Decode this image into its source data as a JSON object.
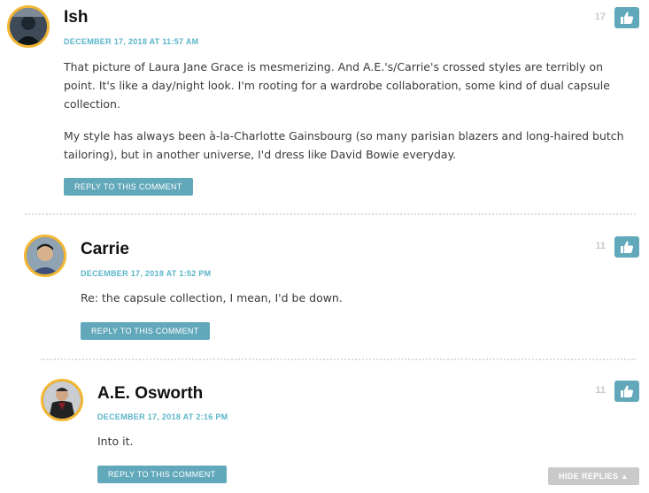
{
  "comments": [
    {
      "author": "Ish",
      "date": "December 17, 2018 at 11:57 am",
      "votes": "17",
      "paragraphs": [
        "That picture of Laura Jane Grace is mesmerizing. And A.E.'s/Carrie's crossed styles are terribly on point. It's like a day/night look. I'm rooting for a wardrobe collaboration, some kind of dual capsule collection.",
        "My style has always been à-la-Charlotte Gainsbourg (so many parisian blazers and long-haired butch tailoring), but in another universe, I'd dress like David Bowie everyday."
      ],
      "reply_label": "Reply to this comment"
    },
    {
      "author": "Carrie",
      "date": "December 17, 2018 at 1:52 pm",
      "votes": "11",
      "paragraphs": [
        "Re: the capsule collection, I mean, I'd be down."
      ],
      "reply_label": "Reply to this comment"
    },
    {
      "author": "A.E. Osworth",
      "date": "December 17, 2018 at 2:16 pm",
      "votes": "11",
      "paragraphs": [
        "Into it."
      ],
      "reply_label": "Reply to this comment"
    }
  ],
  "hide_replies_label": "Hide replies",
  "icons": {
    "like": "thumbs-up-icon",
    "hide": "triangle-up-icon"
  },
  "colors": {
    "accent": "#62a8bb",
    "date": "#5ab4c8",
    "avatar_ring": "#f2b632",
    "muted": "#c9c9c9"
  }
}
